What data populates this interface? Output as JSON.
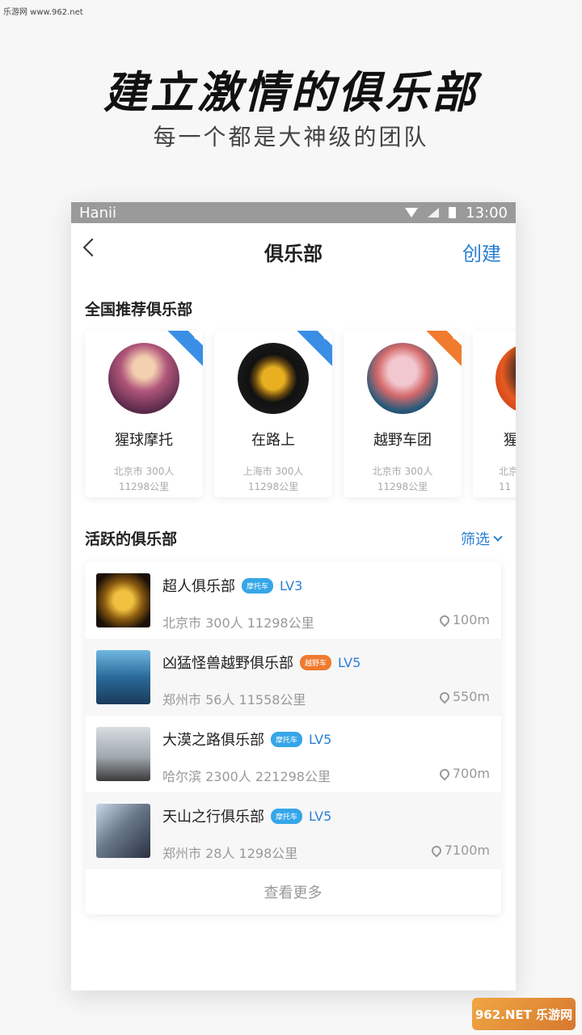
{
  "watermark_top": "乐游网 www.962.net",
  "headline": "建立激情的俱乐部",
  "subline": "每一个都是大神级的团队",
  "status": {
    "carrier": "Hanii",
    "time": "13:00"
  },
  "nav": {
    "title": "俱乐部",
    "create": "创建"
  },
  "recommended": {
    "title": "全国推荐俱乐部",
    "cards": [
      {
        "name": "猩球摩托",
        "meta": "北京市 300人",
        "distance": "11298公里",
        "ribbon_color": "#3a8ee6",
        "icon": "motorcycle-icon"
      },
      {
        "name": "在路上",
        "meta": "上海市 300人",
        "distance": "11298公里",
        "ribbon_color": "#3a8ee6",
        "icon": "motorcycle-icon"
      },
      {
        "name": "越野车团",
        "meta": "北京市 300人",
        "distance": "11298公里",
        "ribbon_color": "#f07a2e",
        "icon": "offroad-icon"
      },
      {
        "name": "猩",
        "meta": "北京",
        "distance": "11",
        "ribbon_color": "#3a8ee6",
        "icon": "motorcycle-icon"
      }
    ]
  },
  "active": {
    "title": "活跃的俱乐部",
    "filter": "筛选",
    "items": [
      {
        "name": "超人俱乐部",
        "badge": "摩托车",
        "badge_color": "#35a6e8",
        "level": "LV3",
        "meta": "北京市 300人 11298公里",
        "distance": "100m"
      },
      {
        "name": "凶猛怪兽越野俱乐部",
        "badge": "越野车",
        "badge_color": "#f07a2e",
        "level": "LV5",
        "meta": "郑州市 56人 11558公里",
        "distance": "550m"
      },
      {
        "name": "大漠之路俱乐部",
        "badge": "摩托车",
        "badge_color": "#35a6e8",
        "level": "LV5",
        "meta": "哈尔滨 2300人 221298公里",
        "distance": "700m"
      },
      {
        "name": "天山之行俱乐部",
        "badge": "摩托车",
        "badge_color": "#35a6e8",
        "level": "LV5",
        "meta": "郑州市 28人 1298公里",
        "distance": "7100m"
      }
    ],
    "more": "查看更多"
  },
  "watermark_bottom": "962.NET 乐游网"
}
